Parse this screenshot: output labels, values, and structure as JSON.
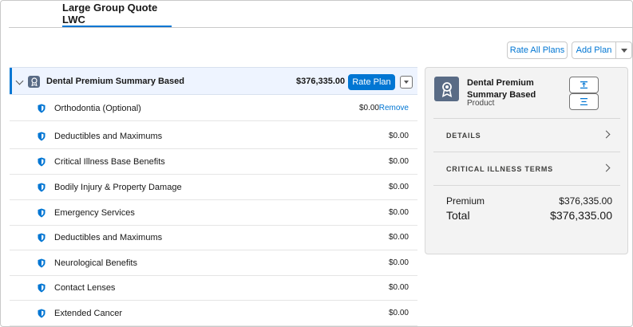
{
  "tabs": [
    {
      "label": "Large Group Quote LWC"
    }
  ],
  "toolbar": {
    "rate_all_label": "Rate All Plans",
    "add_plan_label": "Add Plan"
  },
  "plan": {
    "title": "Dental Premium Summary Based",
    "total": "$376,335.00",
    "rate_label": "Rate Plan",
    "benefits": [
      {
        "label": "Orthodontia (Optional)",
        "price": "$0.00",
        "action": "Remove"
      },
      {
        "label": "Deductibles and Maximums",
        "price": "$0.00"
      },
      {
        "label": "Critical Illness Base Benefits",
        "price": "$0.00"
      },
      {
        "label": "Bodily Injury & Property Damage",
        "price": "$0.00"
      },
      {
        "label": "Emergency Services",
        "price": "$0.00"
      },
      {
        "label": "Deductibles and Maximums",
        "price": "$0.00"
      },
      {
        "label": "Neurological Benefits",
        "price": "$0.00"
      },
      {
        "label": "Contact Lenses",
        "price": "$0.00"
      },
      {
        "label": "Extended Cancer",
        "price": "$0.00"
      }
    ]
  },
  "product_panel": {
    "title": "Dental Premium Summary Based",
    "subtitle": "Product",
    "sections": [
      {
        "label": "DETAILS"
      },
      {
        "label": "CRITICAL ILLNESS TERMS"
      }
    ],
    "summary": {
      "premium_label": "Premium",
      "premium_value": "$376,335.00",
      "total_label": "Total",
      "total_value": "$376,335.00"
    }
  },
  "colors": {
    "brand": "#0176d3",
    "icon_bg": "#596b85",
    "header_bg": "#eef4ff"
  },
  "icons": {
    "plan": "award-icon",
    "benefit": "shield-icon",
    "expand": "chevron-down-icon",
    "section": "chevron-right-icon"
  }
}
